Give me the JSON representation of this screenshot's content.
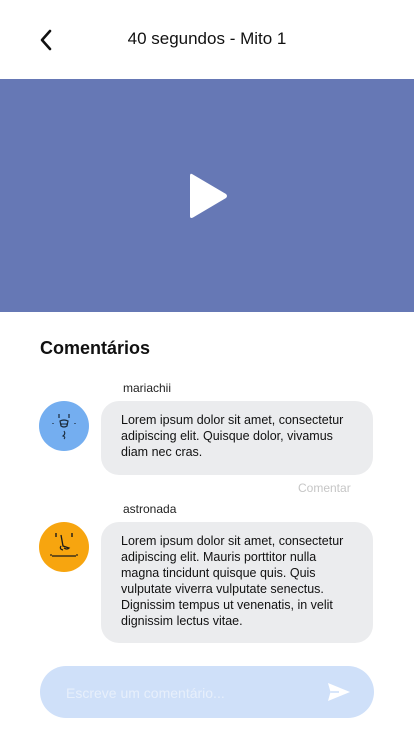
{
  "header": {
    "title": "40 segundos - Mito 1",
    "back_icon": "chevron-left-icon"
  },
  "video": {
    "background": "#6678b5",
    "play_icon": "play-icon"
  },
  "comments_section": {
    "title": "Comentários",
    "comment_link": "Comentar",
    "comments": [
      {
        "username": "mariachii",
        "avatar_color": "#74aef0",
        "text": "Lorem ipsum dolor sit amet, consectetur adipiscing elit. Quisque dolor, vivamus diam nec cras."
      },
      {
        "username": "astronada",
        "avatar_color": "#f7a50f",
        "text": "Lorem ipsum dolor sit amet, consectetur adipiscing elit. Mauris porttitor nulla magna tincidunt quisque quis. Quis vulputate viverra vulputate senectus. Dignissim tempus ut venenatis, in velit dignissim lectus vitae."
      }
    ]
  },
  "composer": {
    "placeholder": "Escreve um comentário...",
    "value": "",
    "send_icon": "send-icon"
  },
  "colors": {
    "accent": "#6678b5",
    "bubble": "#ebecee",
    "input_bg": "#cfe0f9"
  }
}
